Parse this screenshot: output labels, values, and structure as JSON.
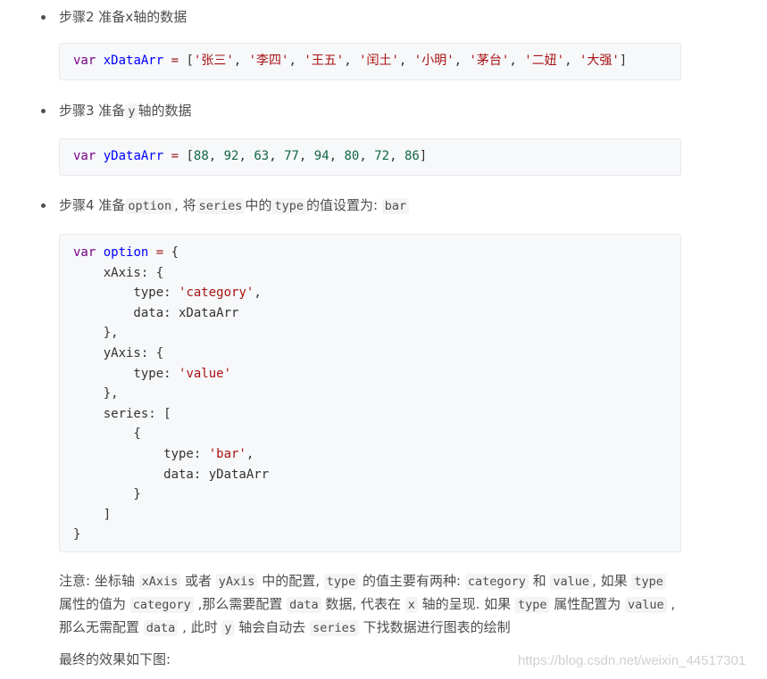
{
  "step2": {
    "label": "步骤2 准备x轴的数据"
  },
  "code1": [
    [
      [
        "k",
        "var"
      ],
      [
        "t",
        " "
      ],
      [
        "v",
        "xDataArr"
      ],
      [
        "t",
        " "
      ],
      [
        "o",
        "="
      ],
      [
        "t",
        " ["
      ],
      [
        "s",
        "'张三'"
      ],
      [
        "t",
        ", "
      ],
      [
        "s",
        "'李四'"
      ],
      [
        "t",
        ", "
      ],
      [
        "s",
        "'王五'"
      ],
      [
        "t",
        ", "
      ],
      [
        "s",
        "'闰土'"
      ],
      [
        "t",
        ", "
      ],
      [
        "s",
        "'小明'"
      ],
      [
        "t",
        ", "
      ],
      [
        "s",
        "'茅台'"
      ],
      [
        "t",
        ", "
      ],
      [
        "s",
        "'二妞'"
      ],
      [
        "t",
        ", "
      ],
      [
        "s",
        "'大强'"
      ],
      [
        "t",
        "]"
      ]
    ]
  ],
  "step3": {
    "a": "步骤3 准备",
    "code": "y",
    "b": "轴的数据"
  },
  "code2": [
    [
      [
        "k",
        "var"
      ],
      [
        "t",
        " "
      ],
      [
        "v",
        "yDataArr"
      ],
      [
        "t",
        " "
      ],
      [
        "o",
        "="
      ],
      [
        "t",
        " ["
      ],
      [
        "n",
        "88"
      ],
      [
        "t",
        ", "
      ],
      [
        "n",
        "92"
      ],
      [
        "t",
        ", "
      ],
      [
        "n",
        "63"
      ],
      [
        "t",
        ", "
      ],
      [
        "n",
        "77"
      ],
      [
        "t",
        ", "
      ],
      [
        "n",
        "94"
      ],
      [
        "t",
        ", "
      ],
      [
        "n",
        "80"
      ],
      [
        "t",
        ", "
      ],
      [
        "n",
        "72"
      ],
      [
        "t",
        ", "
      ],
      [
        "n",
        "86"
      ],
      [
        "t",
        "]"
      ]
    ]
  ],
  "step4": {
    "a": "步骤4 准备",
    "c1": "option",
    "b": ", 将",
    "c2": "series",
    "c": "中的",
    "c3": "type",
    "d": "的值设置为: ",
    "c4": "bar"
  },
  "code3": [
    [
      [
        "k",
        "var"
      ],
      [
        "t",
        " "
      ],
      [
        "v",
        "option"
      ],
      [
        "t",
        " "
      ],
      [
        "o",
        "="
      ],
      [
        "t",
        " {"
      ]
    ],
    [
      [
        "t",
        "    xAxis: {"
      ]
    ],
    [
      [
        "t",
        "        type: "
      ],
      [
        "s",
        "'category'"
      ],
      [
        "t",
        ","
      ]
    ],
    [
      [
        "t",
        "        data: xDataArr"
      ]
    ],
    [
      [
        "t",
        "    },"
      ]
    ],
    [
      [
        "t",
        "    yAxis: {"
      ]
    ],
    [
      [
        "t",
        "        type: "
      ],
      [
        "s",
        "'value'"
      ]
    ],
    [
      [
        "t",
        "    },"
      ]
    ],
    [
      [
        "t",
        "    series: ["
      ]
    ],
    [
      [
        "t",
        "        {"
      ]
    ],
    [
      [
        "t",
        "            type: "
      ],
      [
        "s",
        "'bar'"
      ],
      [
        "t",
        ","
      ]
    ],
    [
      [
        "t",
        "            data: yDataArr"
      ]
    ],
    [
      [
        "t",
        "        }"
      ]
    ],
    [
      [
        "t",
        "    ]"
      ]
    ],
    [
      [
        "t",
        "}"
      ]
    ]
  ],
  "note": [
    [
      [
        "t",
        "注意: 坐标轴 "
      ],
      [
        "c",
        "xAxis"
      ],
      [
        "t",
        " 或者 "
      ],
      [
        "c",
        "yAxis"
      ],
      [
        "t",
        " 中的配置, "
      ],
      [
        "c",
        "type"
      ],
      [
        "t",
        " 的值主要有两种: "
      ],
      [
        "c",
        "category"
      ],
      [
        "t",
        " 和 "
      ],
      [
        "c",
        "value"
      ],
      [
        "t",
        ", 如果 "
      ],
      [
        "c",
        "type"
      ]
    ],
    [
      [
        "t",
        "属性的值为 "
      ],
      [
        "c",
        "category"
      ],
      [
        "t",
        " ,那么需要配置 "
      ],
      [
        "c",
        "data"
      ],
      [
        "t",
        " 数据, 代表在 "
      ],
      [
        "c",
        "x"
      ],
      [
        "t",
        " 轴的呈现. 如果 "
      ],
      [
        "c",
        "type"
      ],
      [
        "t",
        " 属性配置为 "
      ],
      [
        "c",
        "value"
      ],
      [
        "t",
        " ,"
      ]
    ],
    [
      [
        "t",
        "那么无需配置 "
      ],
      [
        "c",
        "data"
      ],
      [
        "t",
        " , 此时 "
      ],
      [
        "c",
        "y"
      ],
      [
        "t",
        " 轴会自动去 "
      ],
      [
        "c",
        "series"
      ],
      [
        "t",
        " 下找数据进行图表的绘制"
      ]
    ]
  ],
  "final": "最终的效果如下图:",
  "watermark": "https://blog.csdn.net/weixin_44517301"
}
